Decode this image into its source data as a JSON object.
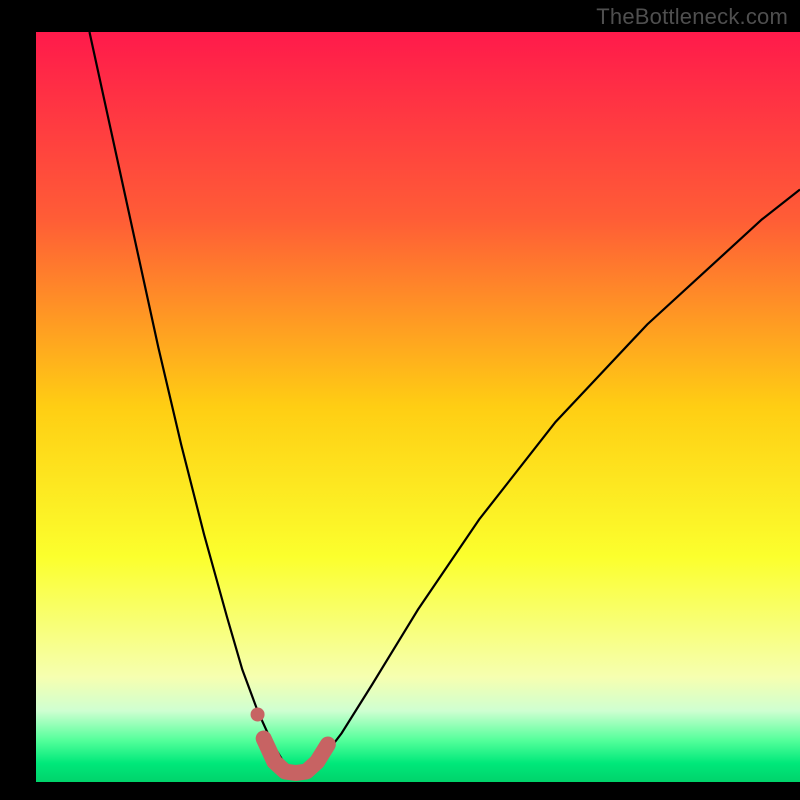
{
  "watermark": "TheBottleneck.com",
  "chart_data": {
    "type": "line",
    "title": "",
    "xlabel": "",
    "ylabel": "",
    "xlim": [
      0,
      100
    ],
    "ylim": [
      0,
      100
    ],
    "background_gradient": {
      "stops": [
        {
          "offset": 0.0,
          "color": "#ff1a4b"
        },
        {
          "offset": 0.25,
          "color": "#ff5d36"
        },
        {
          "offset": 0.5,
          "color": "#ffce13"
        },
        {
          "offset": 0.7,
          "color": "#fbff2d"
        },
        {
          "offset": 0.86,
          "color": "#f6ffb0"
        },
        {
          "offset": 0.905,
          "color": "#cfffd1"
        },
        {
          "offset": 0.945,
          "color": "#52ff9a"
        },
        {
          "offset": 0.975,
          "color": "#00e87a"
        },
        {
          "offset": 1.0,
          "color": "#00d36b"
        }
      ]
    },
    "series": [
      {
        "name": "bottleneck-curve",
        "color": "#000000",
        "stroke_width": 2.2,
        "x": [
          7.0,
          10.0,
          13.0,
          16.0,
          19.0,
          22.0,
          25.0,
          27.0,
          29.0,
          31.0,
          32.5,
          34.0,
          35.5,
          37.0,
          40.0,
          44.0,
          50.0,
          58.0,
          68.0,
          80.0,
          95.0,
          100.0
        ],
        "values": [
          100.0,
          86.0,
          72.0,
          58.0,
          45.0,
          33.0,
          22.0,
          15.0,
          9.5,
          5.0,
          2.5,
          1.4,
          1.4,
          2.5,
          6.5,
          13.0,
          23.0,
          35.0,
          48.0,
          61.0,
          75.0,
          79.0
        ]
      },
      {
        "name": "highlight-band",
        "color": "#c76363",
        "stroke_width": 16,
        "linecap": "round",
        "x": [
          29.8,
          31.2,
          32.6,
          34.0,
          35.4,
          36.8,
          38.2
        ],
        "values": [
          5.8,
          2.7,
          1.4,
          1.2,
          1.4,
          2.7,
          5.0
        ]
      }
    ],
    "markers": [
      {
        "name": "highlight-dot",
        "x": 29.0,
        "y": 9.0,
        "r": 7,
        "color": "#c76363"
      }
    ]
  }
}
